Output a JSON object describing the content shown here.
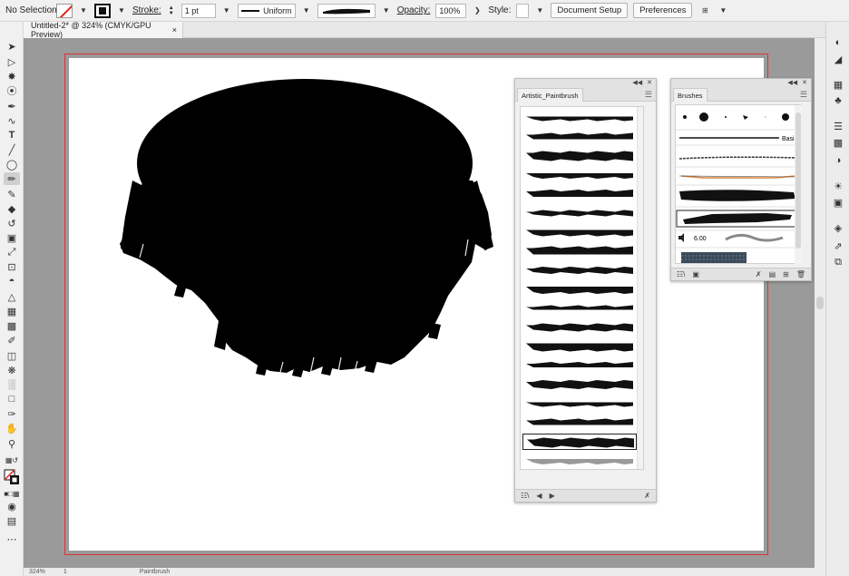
{
  "control_bar": {
    "selection_status": "No Selection",
    "stroke_label": "Stroke:",
    "stroke_weight": "1 pt",
    "profile": "Uniform",
    "opacity_label": "Opacity:",
    "opacity_value": "100%",
    "style_label": "Style:",
    "document_setup_label": "Document Setup",
    "preferences_label": "Preferences"
  },
  "document_tab": {
    "title": "Untitled-2* @ 324% (CMYK/GPU Preview)",
    "close": "×"
  },
  "artistic_panel": {
    "tab_label": "Artistic_Paintbrush",
    "stroke_count": 19,
    "selected_index": 17
  },
  "brushes_panel": {
    "tab_label": "Brushes",
    "basic_label": "Basic",
    "weight_value": "6.00"
  },
  "status_bar": {
    "zoom": "324%",
    "artboard_number": "1",
    "current_tool": "Paintbrush"
  },
  "colors": {
    "art": "#000000",
    "bleed_line": "#d33333",
    "pasteboard": "#9a9a9a",
    "accent_orange": "#d9843c"
  }
}
